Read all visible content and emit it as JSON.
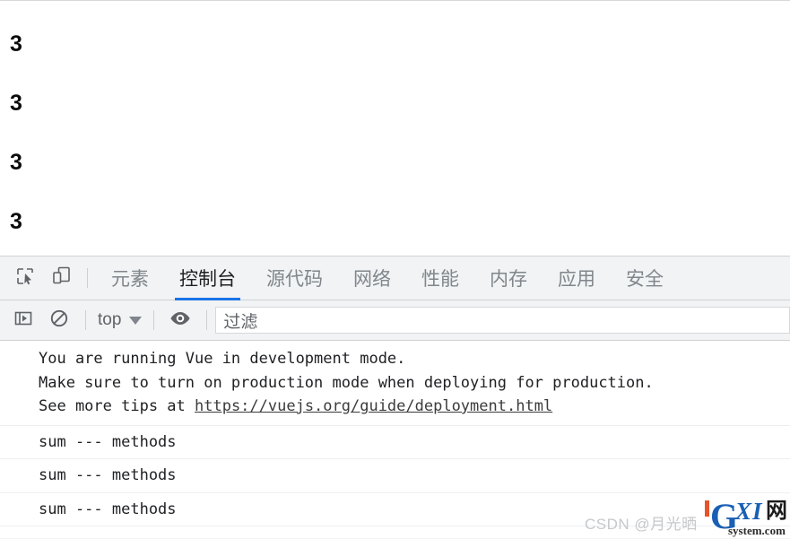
{
  "page": {
    "values": [
      "3",
      "3",
      "3",
      "3"
    ]
  },
  "devtools": {
    "icons": {
      "inspect": "inspect-element-icon",
      "device": "device-toolbar-icon",
      "sidebar": "console-sidebar-icon",
      "clear": "clear-console-icon",
      "eye": "live-expression-eye-icon"
    },
    "tabs": [
      {
        "label": "元素",
        "active": false
      },
      {
        "label": "控制台",
        "active": true
      },
      {
        "label": "源代码",
        "active": false
      },
      {
        "label": "网络",
        "active": false
      },
      {
        "label": "性能",
        "active": false
      },
      {
        "label": "内存",
        "active": false
      },
      {
        "label": "应用",
        "active": false
      },
      {
        "label": "安全",
        "active": false
      }
    ],
    "active_tab_underline_color": "#1a73e8",
    "console_toolbar": {
      "context": "top",
      "filter_placeholder": "过滤"
    },
    "messages": [
      {
        "type": "warning-block",
        "lines": [
          "You are running Vue in development mode.",
          "Make sure to turn on production mode when deploying for production.",
          "See more tips at "
        ],
        "link": "https://vuejs.org/guide/deployment.html"
      },
      {
        "type": "log",
        "text": "sum --- methods"
      },
      {
        "type": "log",
        "text": "sum --- methods"
      },
      {
        "type": "log",
        "text": "sum --- methods"
      }
    ]
  },
  "watermarks": {
    "csdn": "CSDN @月光晒",
    "logo": {
      "g": "G",
      "xi": "XI",
      "cjk": "网",
      "domain": "system.com"
    }
  }
}
